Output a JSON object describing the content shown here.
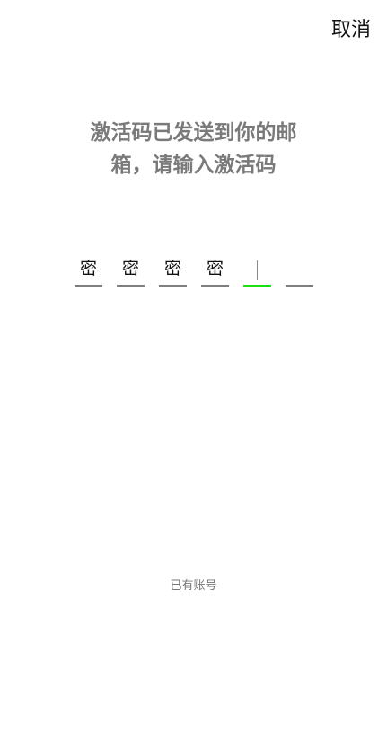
{
  "header": {
    "cancel_label": "取消"
  },
  "title": {
    "line1": "激活码已发送到你的邮",
    "line2": "箱，请输入激活码"
  },
  "code": {
    "cells": [
      "密",
      "密",
      "密",
      "密",
      "",
      ""
    ],
    "active_index": 4
  },
  "footer": {
    "has_account_label": "已有账号"
  },
  "colors": {
    "active_underline": "#19e019",
    "inactive_underline": "#7f7f7f",
    "title": "#7a7a7a"
  }
}
